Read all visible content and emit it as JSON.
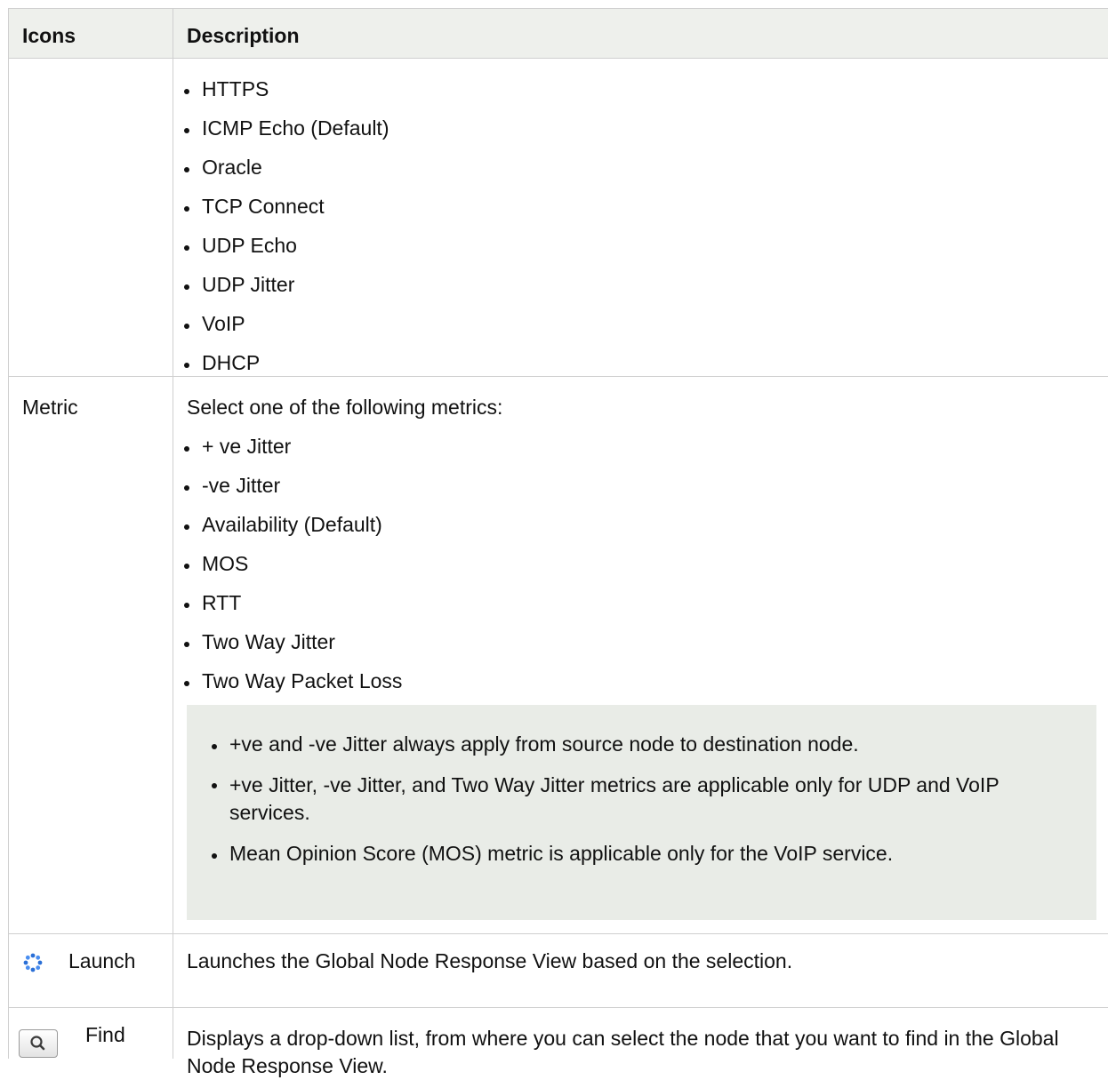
{
  "table": {
    "headers": {
      "icons": "Icons",
      "description": "Description"
    },
    "service_row": {
      "items": [
        "HTTPS",
        "ICMP Echo (Default)",
        "Oracle",
        "TCP Connect",
        "UDP Echo",
        "UDP Jitter",
        "VoIP",
        "DHCP"
      ]
    },
    "metric_row": {
      "label": "Metric",
      "intro": "Select one of the following metrics:",
      "items": [
        "+ ve Jitter",
        "-ve Jitter",
        "Availability (Default)",
        "MOS",
        "RTT",
        "Two Way Jitter",
        "Two Way Packet Loss"
      ],
      "notes": [
        "+ve and -ve Jitter always apply from source node to destination node.",
        "+ve Jitter, -ve Jitter, and Two Way Jitter metrics are applicable only for UDP and VoIP services.",
        "Mean Opinion Score (MOS) metric is applicable only for the VoIP service."
      ]
    },
    "launch_row": {
      "label": "Launch",
      "icon": "launch-gear-icon",
      "description": "Launches the Global Node Response View based on the selection."
    },
    "find_row": {
      "label": "Find",
      "icon": "magnifier-icon",
      "description": "Displays a drop-down list, from where you can select the node that you want to find in the Global Node Response View."
    }
  }
}
